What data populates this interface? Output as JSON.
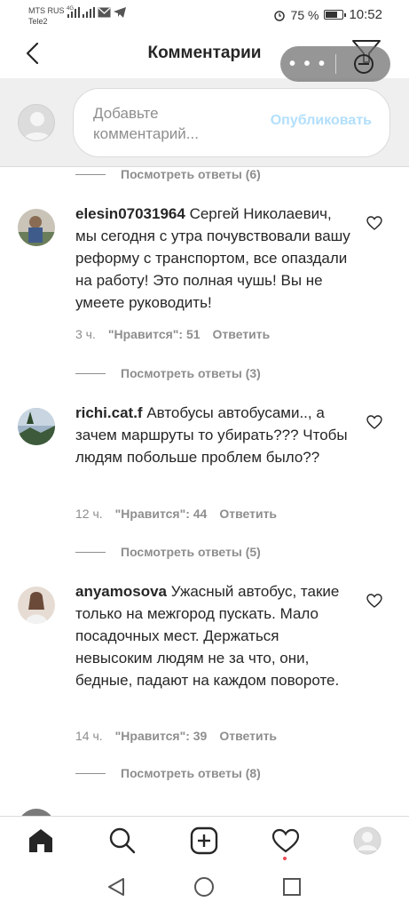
{
  "status_bar": {
    "carrier_1": "MTS RUS",
    "carrier_1_net": "4G",
    "carrier_2": "Tele2",
    "battery_text": "75 %",
    "battery_level": 0.75,
    "time": "10:52"
  },
  "header": {
    "title": "Комментарии",
    "overlay_menu": "• • •"
  },
  "composer": {
    "placeholder": "Добавьте комментарий...",
    "publish_label": "Опубликовать"
  },
  "top_replies": {
    "label": "Посмотреть ответы (6)"
  },
  "comments": [
    {
      "username": "elesin07031964",
      "text": "Сергей Николаевич, мы сегодня с утра почувствовали вашу реформу с транспортом, все опаздали на работу! Это полная чушь! Вы не умеете руководить!",
      "time": "3 ч.",
      "likes": "\"Нравится\": 51",
      "reply_label": "Ответить",
      "replies_label": "Посмотреть ответы (3)"
    },
    {
      "username": "richi.cat.f",
      "text": "Автобусы автобусами.., а зачем маршруты то убирать??? Чтобы людям побольше проблем было??",
      "time": "12 ч.",
      "likes": "\"Нравится\": 44",
      "reply_label": "Ответить",
      "replies_label": "Посмотреть ответы (5)"
    },
    {
      "username": "anyamosova",
      "text": "Ужасный автобус, такие только на межгород пускать. Мало посадочных мест. Держаться невысоким людям не за что, они, бедные, падают на каждом повороте.",
      "time": "14 ч.",
      "likes": "\"Нравится\": 39",
      "reply_label": "Ответить",
      "replies_label": "Посмотреть ответы (8)"
    }
  ],
  "colors": {
    "publish_disabled": "#b2dffc",
    "secondary_text": "#8e8e8e",
    "notification_dot": "#ed4956"
  },
  "bottom_nav": [
    "home-icon",
    "search-icon",
    "new-post-icon",
    "activity-icon",
    "profile-icon"
  ],
  "system_nav": [
    "back-icon",
    "home-circle-icon",
    "recents-icon"
  ]
}
